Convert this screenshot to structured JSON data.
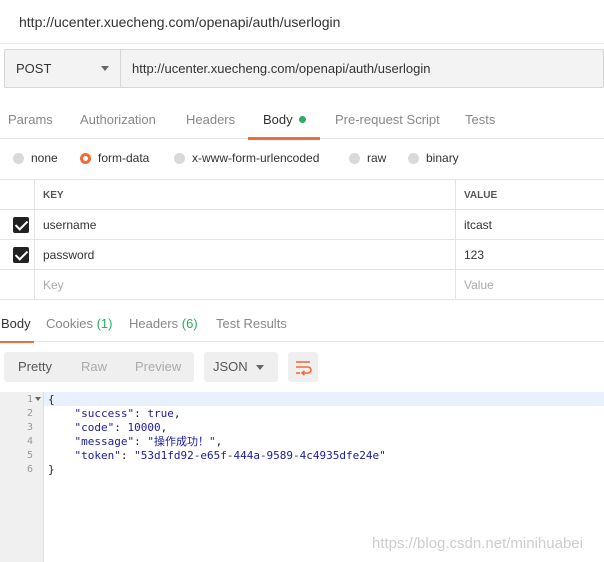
{
  "window": {
    "title": "http://ucenter.xuecheng.com/openapi/auth/userlogin"
  },
  "request": {
    "method": "POST",
    "url": "http://ucenter.xuecheng.com/openapi/auth/userlogin"
  },
  "tabs": {
    "params": "Params",
    "authorization": "Authorization",
    "headers": "Headers",
    "body": "Body",
    "prerequest": "Pre-request Script",
    "tests": "Tests",
    "active": "Body"
  },
  "body_types": {
    "none": "none",
    "form_data": "form-data",
    "urlencoded": "x-www-form-urlencoded",
    "raw": "raw",
    "binary": "binary",
    "selected": "form-data"
  },
  "form_table": {
    "headers": {
      "key": "KEY",
      "value": "VALUE"
    },
    "rows": [
      {
        "checked": true,
        "key": "username",
        "value": "itcast"
      },
      {
        "checked": true,
        "key": "password",
        "value": "123"
      }
    ],
    "placeholder": {
      "key": "Key",
      "value": "Value"
    }
  },
  "response_tabs": {
    "body": "Body",
    "cookies": "Cookies",
    "cookies_count": "(1)",
    "headers": "Headers",
    "headers_count": "(6)",
    "test_results": "Test Results",
    "active": "Body"
  },
  "response_toolbar": {
    "pretty": "Pretty",
    "raw": "Raw",
    "preview": "Preview",
    "format": "JSON",
    "active": "Pretty"
  },
  "editor": {
    "line_numbers": [
      "1",
      "2",
      "3",
      "4",
      "5",
      "6"
    ],
    "lines": [
      {
        "text": "{"
      },
      {
        "key": "\"success\"",
        "value": "true",
        "suffix": ","
      },
      {
        "key": "\"code\"",
        "value": "10000",
        "suffix": ","
      },
      {
        "key": "\"message\"",
        "value": "\"操作成功！\"",
        "suffix": ","
      },
      {
        "key": "\"token\"",
        "value": "\"53d1fd92-e65f-444a-9589-4c4935dfe24e\"",
        "suffix": ""
      },
      {
        "text": "}"
      }
    ]
  },
  "watermark": "https://blog.csdn.net/minihuabei",
  "colors": {
    "accent": "#f26b3a",
    "success": "#27ae60",
    "code": "#1a1aa6"
  }
}
